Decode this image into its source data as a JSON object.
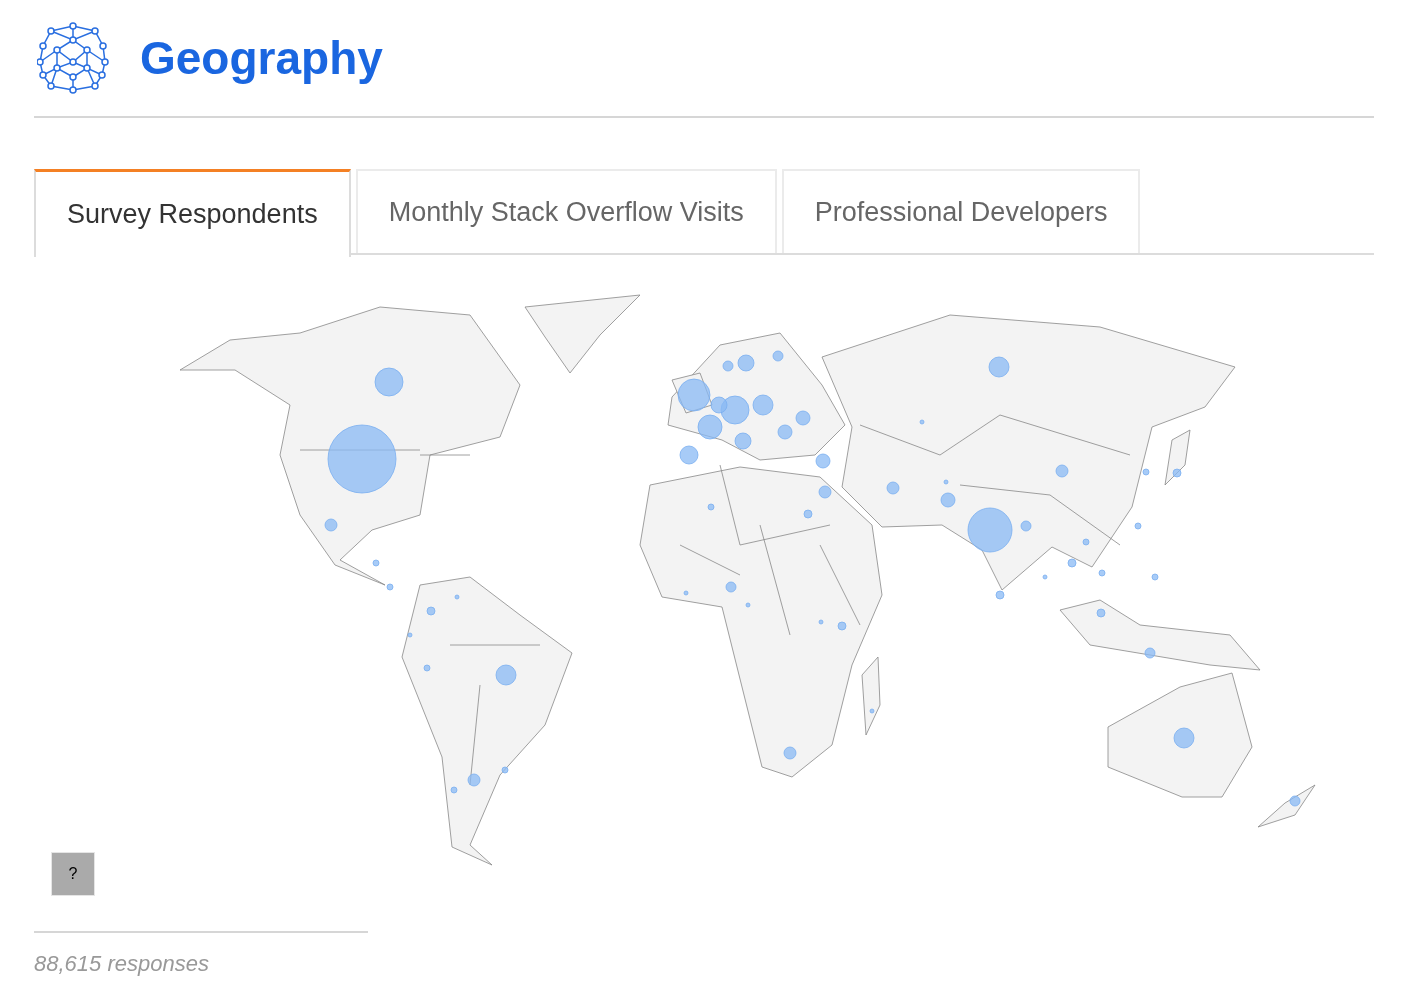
{
  "title": "Geography",
  "tabs": [
    {
      "label": "Survey Respondents",
      "selected": true
    },
    {
      "label": "Monthly Stack Overflow Visits",
      "selected": false
    },
    {
      "label": "Professional Developers",
      "selected": false
    }
  ],
  "help_button": "?",
  "footer": "88,615 responses"
}
